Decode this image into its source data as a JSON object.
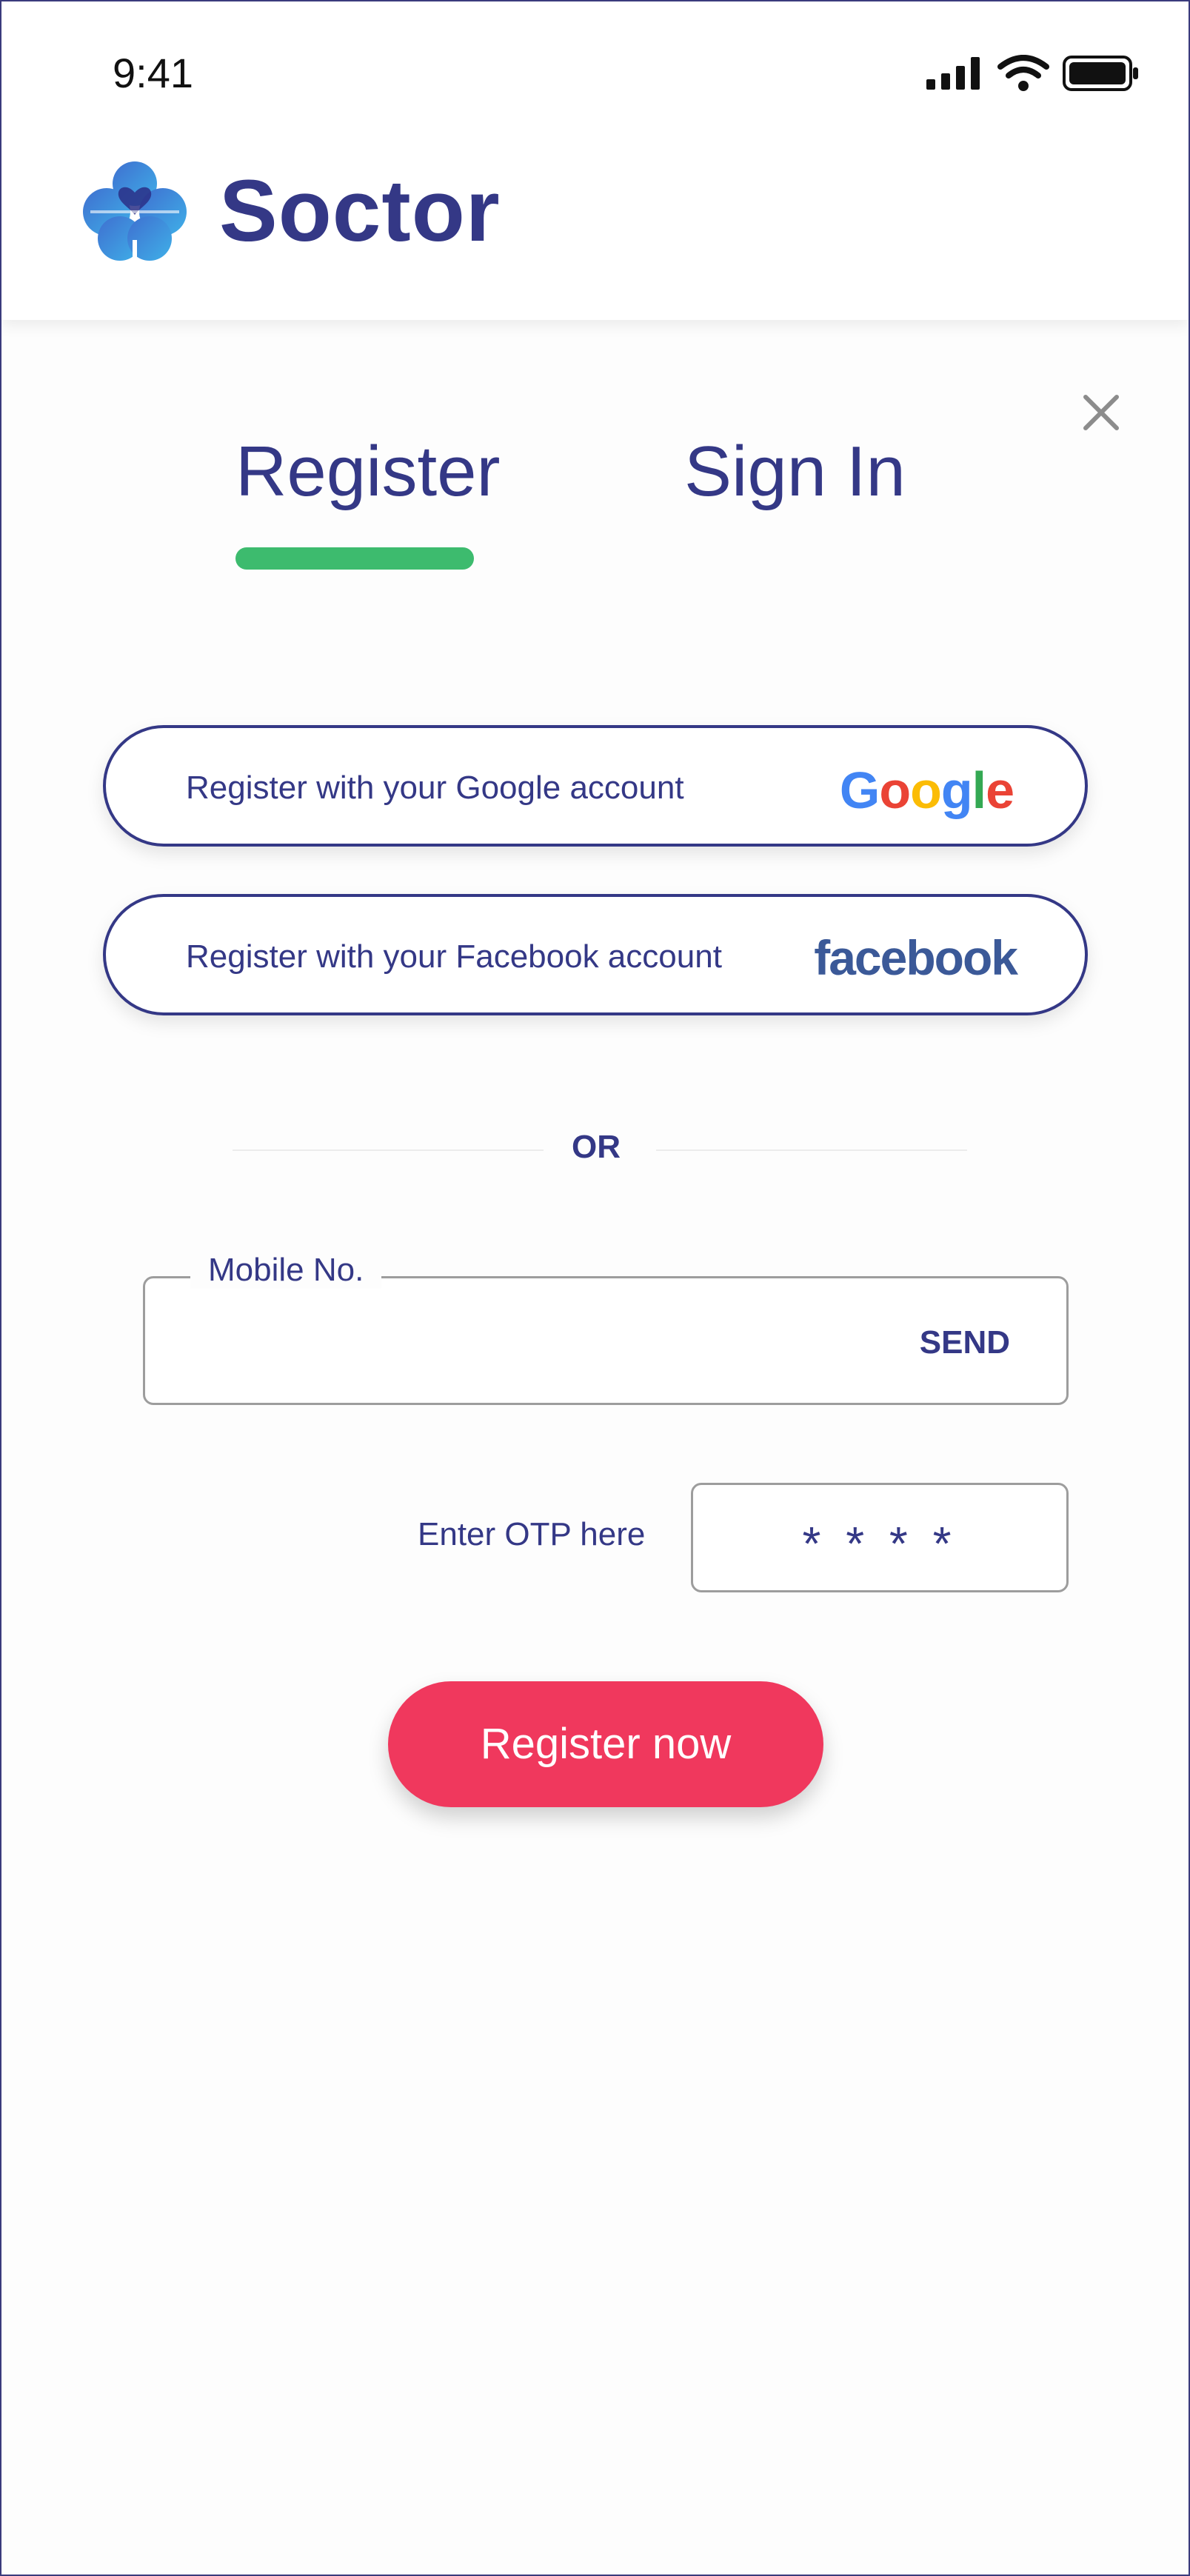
{
  "status_bar": {
    "time": "9:41",
    "icons": [
      "signal-icon",
      "wifi-icon",
      "battery-icon"
    ]
  },
  "header": {
    "brand": "Soctor",
    "logo_icon": "heart-clover-logo-icon"
  },
  "tabs": {
    "register": "Register",
    "signin": "Sign In",
    "active": "Register"
  },
  "social": {
    "google_label": "Register with your Google account",
    "google_logo": "Google",
    "facebook_label": "Register with your Facebook account",
    "facebook_logo": "facebook"
  },
  "divider": {
    "text": "OR"
  },
  "mobile": {
    "legend": "Mobile No.",
    "value": "",
    "send_label": "SEND"
  },
  "otp": {
    "label": "Enter OTP here",
    "value": "* * * *"
  },
  "register_button": "Register now",
  "colors": {
    "brand": "#343886",
    "accent_green": "#3dbb6e",
    "cta_red": "#f0385d",
    "google_blue": "#4285F4",
    "google_red": "#EA4335",
    "google_yellow": "#FBBC05",
    "google_green": "#34A853",
    "facebook_blue": "#3b5998"
  }
}
